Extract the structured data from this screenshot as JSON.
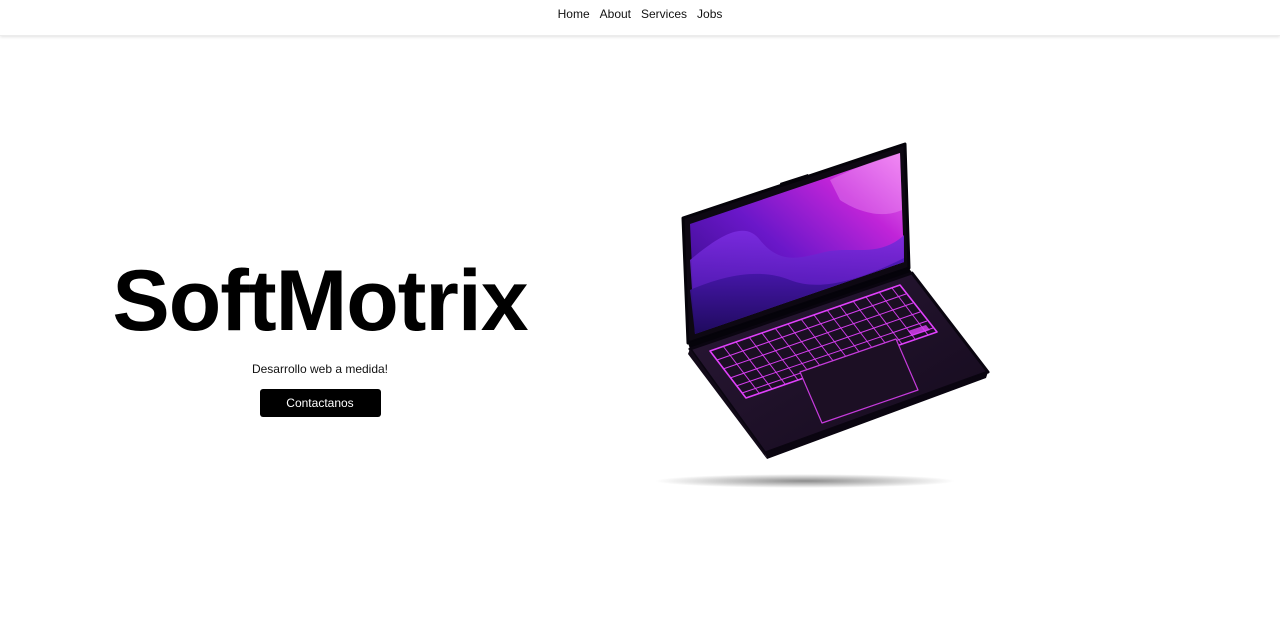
{
  "nav": {
    "items": [
      {
        "label": "Home"
      },
      {
        "label": "About"
      },
      {
        "label": "Services"
      },
      {
        "label": "Jobs"
      }
    ]
  },
  "hero": {
    "title": "SoftMotrix",
    "tagline": "Desarrollo web a medida!",
    "cta_label": "Contactanos"
  },
  "illustration": {
    "icon": "laptop-illustration",
    "accent": "#e040fb",
    "screen_colors": [
      "#4a0ea8",
      "#b01cd6",
      "#e56cf0"
    ],
    "body_color": "#1c1024"
  }
}
